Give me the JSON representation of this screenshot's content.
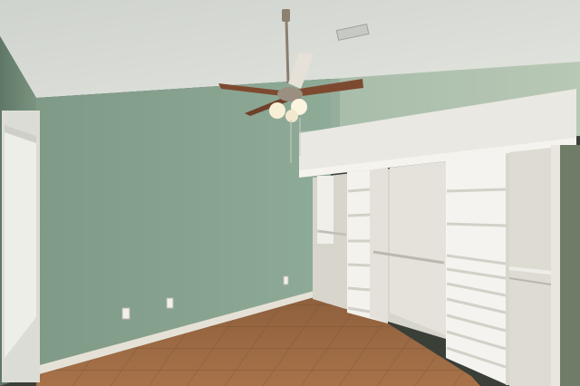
{
  "scene": {
    "description_items": [
      "ceiling-fan",
      "window-blind",
      "open-closet-shelving",
      "tile-floor",
      "outlets"
    ],
    "watermark_text": "",
    "colors": {
      "wall": "#8ea795",
      "wall_shadow": "#6f8a79",
      "ceiling": "#d9dcd6",
      "trim": "#e8e4dc",
      "floor": "#9c6a44",
      "shelving": "#ecebe6"
    }
  }
}
